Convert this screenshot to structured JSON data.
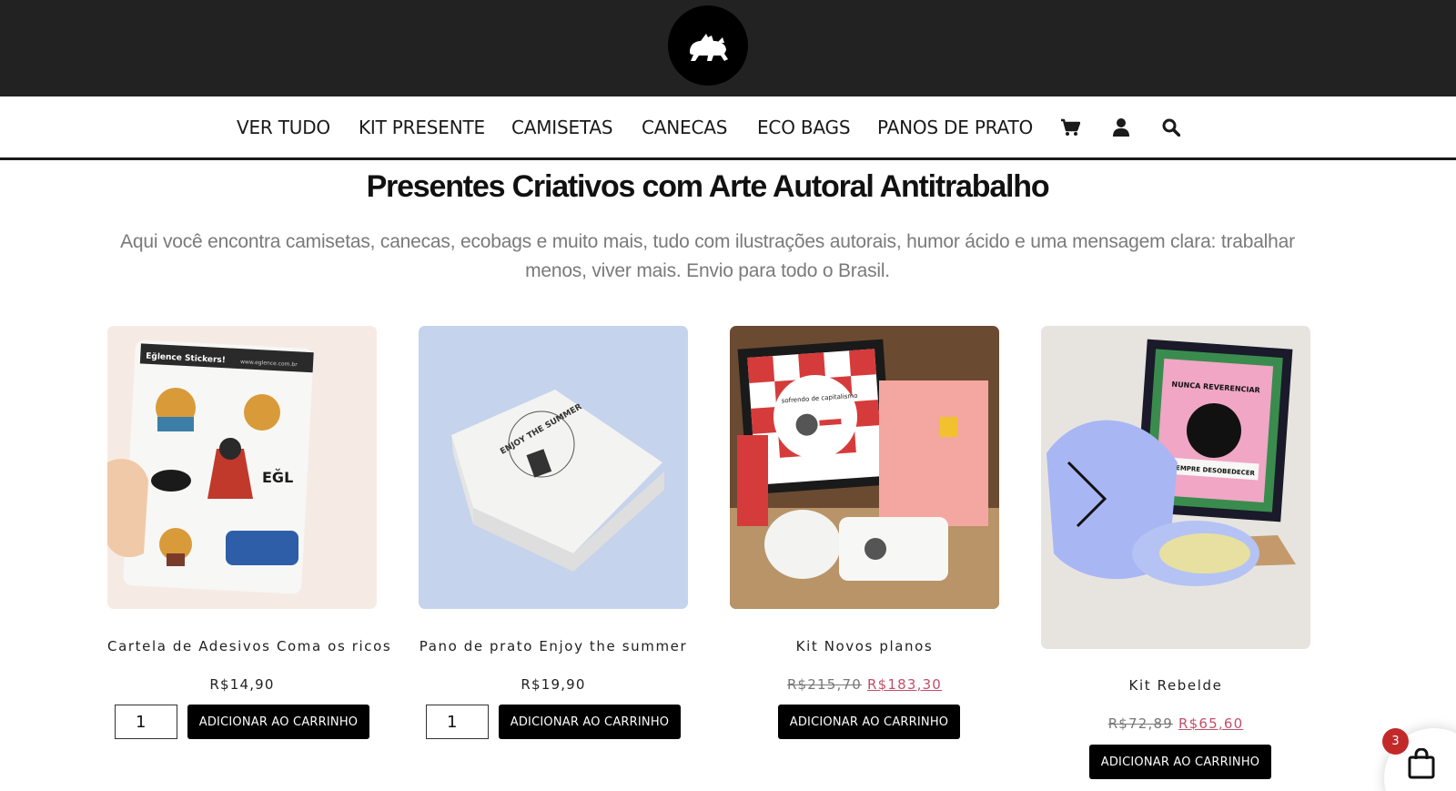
{
  "header": {
    "logo_icon": "dog-silhouette-icon",
    "background": "#222222"
  },
  "nav": {
    "items": [
      {
        "label": "VER TUDO"
      },
      {
        "label": "KIT PRESENTE"
      },
      {
        "label": "CAMISETAS"
      },
      {
        "label": "CANECAS"
      },
      {
        "label": "ECO BAGS"
      },
      {
        "label": "PANOS DE PRATO"
      }
    ],
    "icons": [
      "cart-icon",
      "user-icon",
      "search-icon"
    ]
  },
  "main": {
    "title": "Presentes Criativos com Arte Autoral Antitrabalho",
    "subtitle": "Aqui você encontra camisetas, canecas, ecobags e muito mais, tudo com ilustrações autorais, humor ácido e uma mensagem clara: trabalhar menos, viver mais. Envio para todo o Brasil."
  },
  "products": [
    {
      "name": "Cartela de Adesivos Coma os ricos",
      "price": "R$14,90",
      "quantity": "1",
      "button_label": "ADICIONAR AO CARRINHO",
      "image_text": {
        "brand": "Eğlence Stickers!",
        "url": "www.eglence.com.br",
        "logo": "EĞL"
      }
    },
    {
      "name": "Pano de prato Enjoy the summer",
      "price": "R$19,90",
      "quantity": "1",
      "button_label": "ADICIONAR AO CARRINHO",
      "image_text": {
        "print": "ENJOY THE SUMMER"
      }
    },
    {
      "name": "Kit Novos planos",
      "old_price": "R$215,70",
      "sale_price": "R$183,30",
      "button_label": "ADICIONAR AO CARRINHO",
      "image_text": {
        "print": "sofrendo de capitalismo"
      }
    },
    {
      "name": "Kit Rebelde",
      "old_price": "R$72,89",
      "sale_price": "R$65,60",
      "button_label": "ADICIONAR AO CARRINHO",
      "image_text": {
        "top": "NUNCA REVERENCIAR",
        "bottom": "SEMPRE DESOBEDECER"
      }
    }
  ],
  "cart_widget": {
    "count": "3",
    "icon": "shopping-bag-icon",
    "badge_color": "#c22a2a"
  },
  "colors": {
    "sale": "#c0506a",
    "button": "#000000"
  }
}
